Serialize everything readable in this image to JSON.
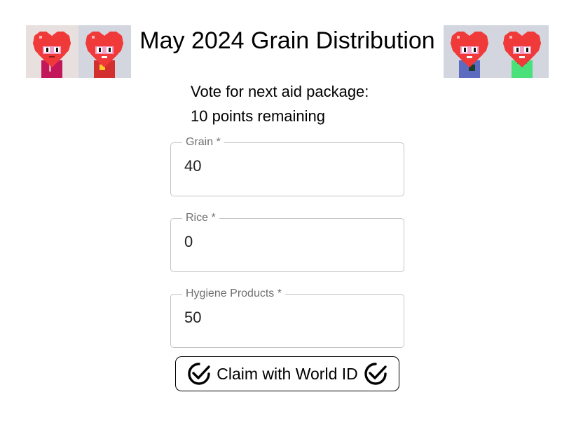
{
  "header": {
    "title": "May 2024 Grain Distribution",
    "avatars": [
      {
        "icon": "heart-character-icon",
        "background": "#e8e0df",
        "shirt": "#c2185b"
      },
      {
        "icon": "heart-character-icon",
        "background": "#d3d6df",
        "shirt": "#d32f2f"
      },
      {
        "icon": "heart-character-icon",
        "background": "#d3d6df",
        "shirt": "#5c6bc0"
      },
      {
        "icon": "heart-character-icon",
        "background": "#d3d6df",
        "shirt": "#4ae07a"
      }
    ]
  },
  "vote": {
    "prompt": "Vote for next aid package:",
    "remaining": "10 points remaining"
  },
  "fields": [
    {
      "label": "Grain *",
      "value": "40"
    },
    {
      "label": "Rice *",
      "value": "0"
    },
    {
      "label": "Hygiene Products *",
      "value": "50"
    }
  ],
  "claim_button": {
    "label": "Claim with World ID",
    "icon": "world-id-check-icon"
  }
}
